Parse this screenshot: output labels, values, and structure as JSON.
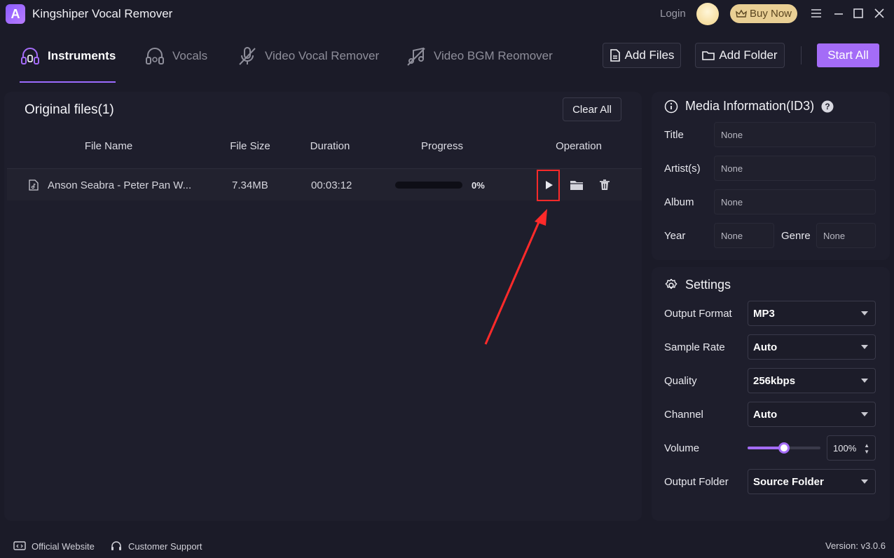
{
  "app": {
    "title": "Kingshiper Vocal Remover",
    "logo_letter": "A"
  },
  "titlebar": {
    "login": "Login",
    "buy_now": "Buy Now"
  },
  "tabs": [
    {
      "label": "Instruments",
      "icon": "headphones-icon",
      "active": true
    },
    {
      "label": "Vocals",
      "icon": "vocals-icon",
      "active": false
    },
    {
      "label": "Video Vocal Remover",
      "icon": "mic-off-icon",
      "active": false
    },
    {
      "label": "Video BGM Reomover",
      "icon": "music-off-icon",
      "active": false
    }
  ],
  "toolbar": {
    "add_files": "Add Files",
    "add_folder": "Add Folder",
    "start_all": "Start All"
  },
  "files_panel": {
    "title": "Original files(1)",
    "clear_all": "Clear All",
    "columns": [
      "File Name",
      "File Size",
      "Duration",
      "Progress",
      "Operation"
    ],
    "rows": [
      {
        "name": "Anson Seabra - Peter Pan W...",
        "size": "7.34MB",
        "duration": "00:03:12",
        "progress": 0,
        "progress_label": "0%"
      }
    ]
  },
  "media_info": {
    "title": "Media Information(ID3)",
    "title_label": "Title",
    "title_value": "None",
    "artist_label": "Artist(s)",
    "artist_value": "None",
    "album_label": "Album",
    "album_value": "None",
    "year_label": "Year",
    "year_value": "None",
    "genre_label": "Genre",
    "genre_value": "None"
  },
  "settings": {
    "title": "Settings",
    "output_format_label": "Output Format",
    "output_format": "MP3",
    "sample_rate_label": "Sample Rate",
    "sample_rate": "Auto",
    "quality_label": "Quality",
    "quality": "256kbps",
    "channel_label": "Channel",
    "channel": "Auto",
    "volume_label": "Volume",
    "volume_value": "100%",
    "volume_fraction": 0.5,
    "output_folder_label": "Output Folder",
    "output_folder": "Source Folder"
  },
  "footer": {
    "website": "Official Website",
    "support": "Customer Support",
    "version": "Version: v3.0.6"
  },
  "colors": {
    "accent": "#a46cf7",
    "background": "#1b1b28",
    "panel": "#1e1e2c",
    "highlight": "#ff2a2a",
    "buy_now": "#e9cf94"
  }
}
